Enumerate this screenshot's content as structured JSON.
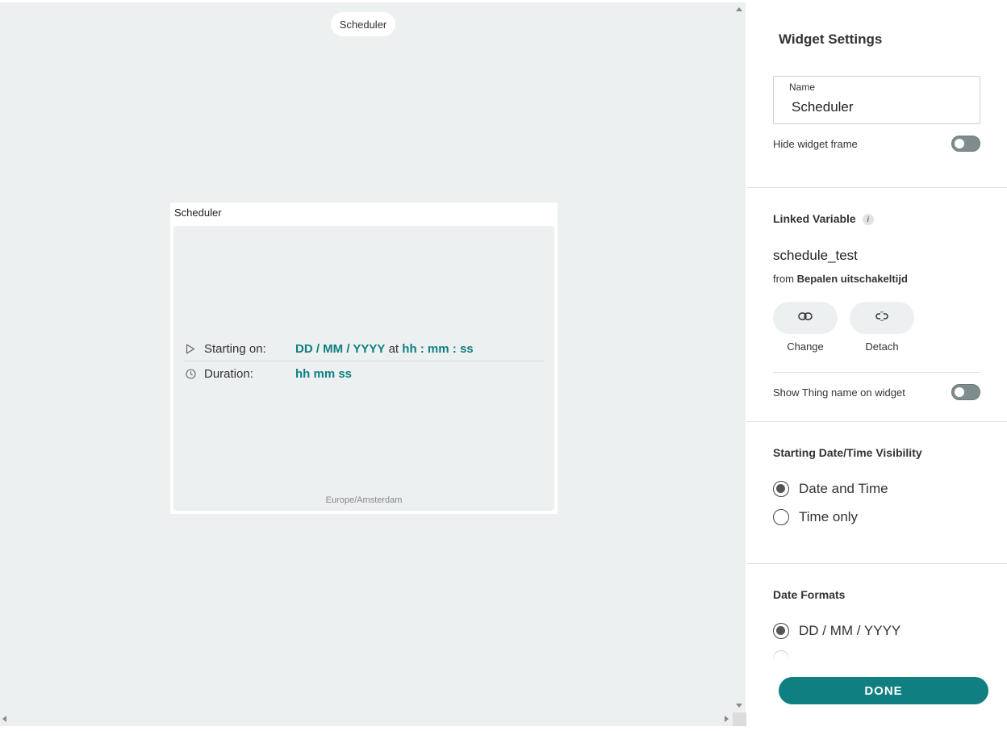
{
  "canvas": {
    "pill_label": "Scheduler",
    "widget": {
      "title": "Scheduler",
      "starting_label": "Starting on:",
      "starting_date": "DD / MM / YYYY",
      "starting_at": "at",
      "starting_time": "hh : mm : ss",
      "duration_label": "Duration:",
      "duration_value": "hh mm ss",
      "timezone": "Europe/Amsterdam"
    }
  },
  "panel": {
    "title": "Widget Settings",
    "name_label": "Name",
    "name_value": "Scheduler",
    "hide_frame_label": "Hide widget frame",
    "linked_variable_title": "Linked Variable",
    "info_glyph": "i",
    "variable_name": "schedule_test",
    "from_prefix": "from",
    "from_thing": "Bepalen uitschakeltijd",
    "change_label": "Change",
    "detach_label": "Detach",
    "show_thing_label": "Show Thing name on widget",
    "visibility_title": "Starting Date/Time Visibility",
    "visibility_options": [
      "Date and Time",
      "Time only"
    ],
    "visibility_selected": "Date and Time",
    "date_formats_title": "Date Formats",
    "date_format_options": [
      "DD / MM / YYYY"
    ],
    "done_label": "DONE"
  },
  "colors": {
    "accent": "#0f7f82",
    "canvas_bg": "#ecf0f0",
    "toggle_off": "#7f8c8d"
  },
  "icons": {
    "start": "play-outline-icon",
    "duration": "clock-icon",
    "change": "link-icon",
    "detach": "unlink-icon"
  },
  "toggles": {
    "hide_widget_frame": false,
    "show_thing_name": false
  }
}
